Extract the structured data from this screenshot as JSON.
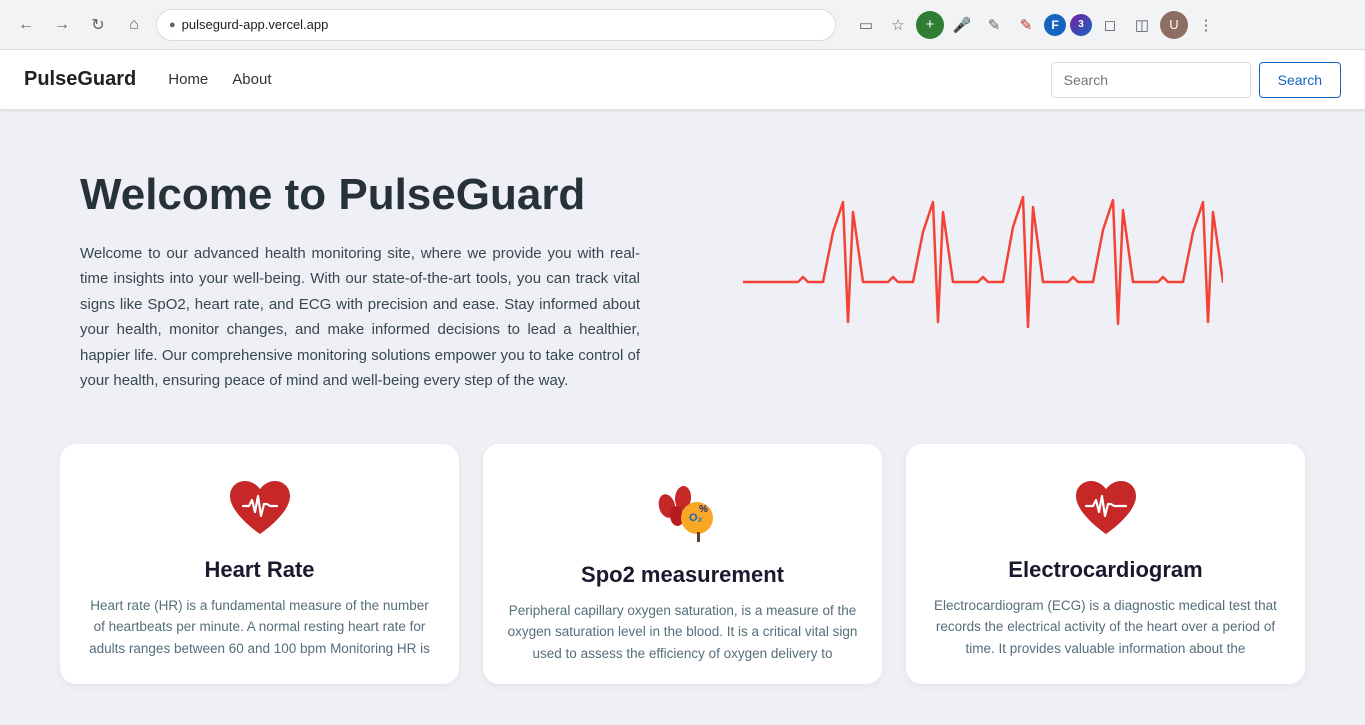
{
  "browser": {
    "url": "pulsegurd-app.vercel.app",
    "nav": {
      "back": "←",
      "forward": "→",
      "reload": "↻",
      "home": "⌂"
    }
  },
  "navbar": {
    "brand": "PulseGuard",
    "links": [
      {
        "label": "Home",
        "name": "home"
      },
      {
        "label": "About",
        "name": "about"
      }
    ],
    "search_placeholder": "Search",
    "search_button_label": "Search"
  },
  "hero": {
    "title": "Welcome to PulseGuard",
    "description": "Welcome to our advanced health monitoring site, where we provide you with real-time insights into your well-being. With our state-of-the-art tools, you can track vital signs like SpO2, heart rate, and ECG with precision and ease. Stay informed about your health, monitor changes, and make informed decisions to lead a healthier, happier life. Our comprehensive monitoring solutions empower you to take control of your health, ensuring peace of mind and well-being every step of the way."
  },
  "cards": [
    {
      "id": "heart-rate",
      "title": "Heart Rate",
      "description": "Heart rate (HR) is a fundamental measure of the number of heartbeats per minute. A normal resting heart rate for adults ranges between 60 and 100 bpm Monitoring HR is",
      "icon": "heart-rate-icon",
      "icon_color": "#b71c1c"
    },
    {
      "id": "spo2",
      "title": "Spo2 measurement",
      "description": "Peripheral capillary oxygen saturation, is a measure of the oxygen saturation level in the blood. It is a critical vital sign used to assess the efficiency of oxygen delivery to",
      "icon": "spo2-icon",
      "icon_color": "#1565c0"
    },
    {
      "id": "ecg",
      "title": "Electrocardiogram",
      "description": "Electrocardiogram (ECG) is a diagnostic medical test that records the electrical activity of the heart over a period of time. It provides valuable information about the",
      "icon": "ecg-icon",
      "icon_color": "#b71c1c"
    }
  ]
}
